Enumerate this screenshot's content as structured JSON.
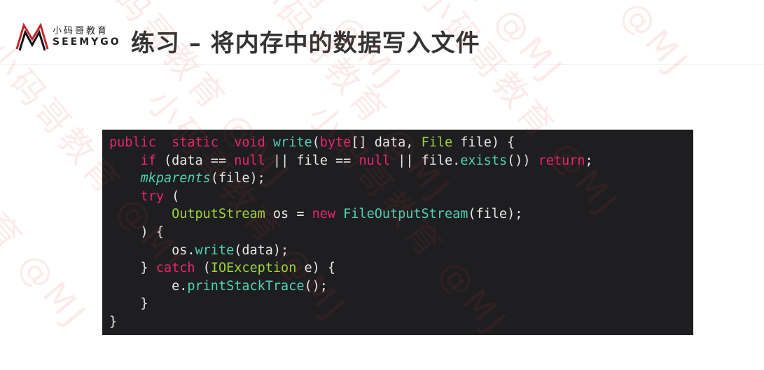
{
  "header": {
    "logo_cn": "小码哥教育",
    "logo_en": "SEEMYGO",
    "title": "练习 – 将内存中的数据写入文件"
  },
  "watermark": "小码哥教育 @MJ",
  "colors": {
    "keyword": "#e8266e",
    "function": "#4fd1b5",
    "type": "#9ed43b",
    "background": "#1e1e20",
    "text": "#e8e8e8"
  },
  "code": [
    [
      [
        "kw",
        "public"
      ],
      [
        "",
        "  "
      ],
      [
        "kw",
        "static"
      ],
      [
        "",
        "  "
      ],
      [
        "kw",
        "void"
      ],
      [
        "",
        " "
      ],
      [
        "fn",
        "write"
      ],
      [
        "",
        "("
      ],
      [
        "kw",
        "byte"
      ],
      [
        "",
        "[] data, "
      ],
      [
        "ty",
        "File"
      ],
      [
        "",
        " file) {"
      ]
    ],
    [
      [
        "",
        "    "
      ],
      [
        "kw",
        "if"
      ],
      [
        "",
        " (data == "
      ],
      [
        "kw",
        "null"
      ],
      [
        "",
        " || file == "
      ],
      [
        "kw",
        "null"
      ],
      [
        "",
        " || file."
      ],
      [
        "fn",
        "exists"
      ],
      [
        "",
        "()) "
      ],
      [
        "kw",
        "return"
      ],
      [
        "",
        ";"
      ]
    ],
    [
      [
        "",
        "    "
      ],
      [
        "it",
        "mkparents"
      ],
      [
        "",
        "(file);"
      ]
    ],
    [
      [
        "",
        "    "
      ],
      [
        "kw",
        "try"
      ],
      [
        "",
        " ("
      ]
    ],
    [
      [
        "",
        "        "
      ],
      [
        "ty",
        "OutputStream"
      ],
      [
        "",
        " os = "
      ],
      [
        "kw",
        "new"
      ],
      [
        "",
        " "
      ],
      [
        "fn",
        "FileOutputStream"
      ],
      [
        "",
        "(file);"
      ]
    ],
    [
      [
        "",
        "    ) {"
      ]
    ],
    [
      [
        "",
        "        os."
      ],
      [
        "fn",
        "write"
      ],
      [
        "",
        "(data);"
      ]
    ],
    [
      [
        "",
        "    } "
      ],
      [
        "kw",
        "catch"
      ],
      [
        "",
        " ("
      ],
      [
        "ty",
        "IOException"
      ],
      [
        "",
        " e) {"
      ]
    ],
    [
      [
        "",
        "        e."
      ],
      [
        "fn",
        "printStackTrace"
      ],
      [
        "",
        "();"
      ]
    ],
    [
      [
        "",
        "    }"
      ]
    ],
    [
      [
        "",
        "}"
      ]
    ]
  ]
}
